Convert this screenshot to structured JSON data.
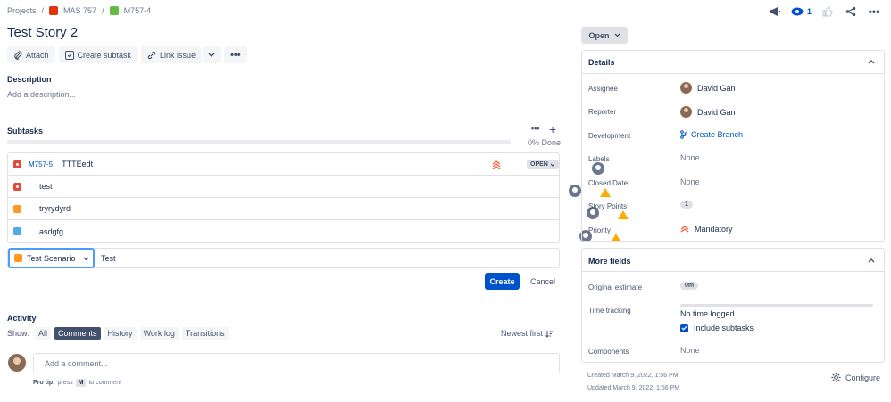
{
  "breadcrumb": {
    "projects": "Projects",
    "project": "MAS 757",
    "issue": "M757-4"
  },
  "header": {
    "watch_count": "1"
  },
  "issue": {
    "title": "Test Story 2",
    "status": "Open"
  },
  "toolbar": {
    "attach": "Attach",
    "create_subtask": "Create subtask",
    "link_issue": "Link issue"
  },
  "description": {
    "heading": "Description",
    "placeholder": "Add a description..."
  },
  "subtasks": {
    "heading": "Subtasks",
    "progress": "0% Done",
    "progress_value": 0,
    "rows": [
      {
        "key": "M757-5",
        "summary": "TTTEedt",
        "type": "bug-icon",
        "status": "OPEN"
      },
      {
        "key": "",
        "summary": "test",
        "type": "bug-icon",
        "status": ""
      },
      {
        "key": "",
        "summary": "tryrydyrd",
        "type": "task-icon",
        "status": ""
      },
      {
        "key": "",
        "summary": "asdgfg",
        "type": "subtask-icon",
        "status": ""
      }
    ],
    "new_type": "Test Scenario",
    "new_summary": "Test",
    "create": "Create",
    "cancel": "Cancel"
  },
  "activity": {
    "heading": "Activity",
    "show": "Show:",
    "tabs": [
      "All",
      "Comments",
      "History",
      "Work log",
      "Transitions"
    ],
    "active_tab": "Comments",
    "sort": "Newest first",
    "comment_placeholder": "Add a comment...",
    "pro_tip_prefix": "Pro tip:",
    "pro_tip_press": "press",
    "pro_tip_key": "M",
    "pro_tip_suffix": "to comment"
  },
  "details": {
    "heading": "Details",
    "fields": [
      {
        "label": "Assignee",
        "value": "David Gan"
      },
      {
        "label": "Reporter",
        "value": "David Gan"
      },
      {
        "label": "Development",
        "value": "Create Branch"
      },
      {
        "label": "Labels",
        "value": "None"
      },
      {
        "label": "Closed Date",
        "value": "None"
      },
      {
        "label": "Story Points",
        "value": "1"
      },
      {
        "label": "Priority",
        "value": "Mandatory"
      }
    ]
  },
  "more_fields": {
    "heading": "More fields",
    "original_estimate_label": "Original estimate",
    "original_estimate": "0m",
    "time_tracking_label": "Time tracking",
    "time_tracking": "No time logged",
    "include_subtasks": "Include subtasks",
    "components_label": "Components",
    "components": "None"
  },
  "footer": {
    "created": "Created March 9, 2022, 1:56 PM",
    "updated": "Updated March 9, 2022, 1:56 PM",
    "configure": "Configure"
  },
  "colors": {
    "accent": "#0052cc",
    "bug": "#e5493a",
    "warning": "#ffab00"
  }
}
